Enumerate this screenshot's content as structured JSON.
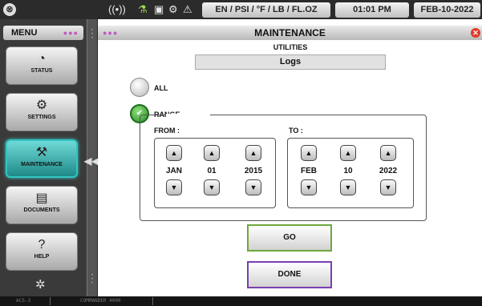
{
  "topbar": {
    "units": "EN / PSI / °F / LB / FL.OZ",
    "time": "01:01 PM",
    "date": "FEB-10-2022",
    "icons": [
      "logo-icon",
      "wireless-icon",
      "process-icon",
      "doc-icon",
      "gear-icon",
      "alarm-icon"
    ]
  },
  "sidebar": {
    "title": "MENU",
    "items": [
      {
        "label": "STATUS",
        "icon": "gauge-icon"
      },
      {
        "label": "SETTINGS",
        "icon": "gear-icon"
      },
      {
        "label": "MAINTENANCE",
        "icon": "tools-icon"
      },
      {
        "label": "DOCUMENTS",
        "icon": "document-icon"
      },
      {
        "label": "HELP",
        "icon": "help-icon"
      }
    ]
  },
  "main": {
    "title": "MAINTENANCE",
    "section": "UTILITIES",
    "selected": "Logs",
    "options": {
      "all": "ALL",
      "range": "RANGE"
    },
    "from": {
      "label": "FROM :",
      "month": "JAN",
      "day": "01",
      "year": "2015"
    },
    "to": {
      "label": "TO :",
      "month": "FEB",
      "day": "10",
      "year": "2022"
    },
    "go": "GO",
    "done": "DONE"
  },
  "footer": {
    "left": "ACS-3",
    "middle": "COMMANDER 4000"
  }
}
